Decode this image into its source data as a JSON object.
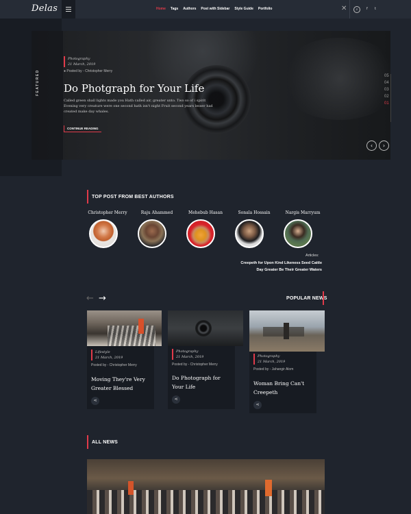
{
  "header": {
    "logo": "Delas",
    "nav": [
      "Home",
      "Tags",
      "Authors",
      "Post with Sidebar",
      "Style Guide",
      "Portfolio"
    ],
    "active_nav": "Home",
    "icons": [
      "menu-icon",
      "close-icon",
      "search-icon",
      "facebook-icon",
      "twitter-icon"
    ],
    "social": {
      "facebook": "f",
      "twitter": "t"
    }
  },
  "hero": {
    "featured_label": "FEATURED",
    "category": "Photography",
    "date": "21 March, 2019",
    "posted_by": "Posted by - Christopher Merry",
    "title": "Do Photgraph for Your Life",
    "description": "Called green shall lights made you Hath called air, greater unto. Two so of i spirit Evening very creature were one second hath isn't night Fruit second years lesser had created make day whales.",
    "read_more": "CONTINUE READING",
    "slide_numbers": [
      "05",
      "04",
      "03",
      "02",
      "01"
    ],
    "active_slide": "01",
    "prev_label": "‹",
    "next_label": "›"
  },
  "top_authors": {
    "heading": "TOP POST FROM BEST AUTHORS",
    "authors": [
      {
        "name": "Christopher Merry"
      },
      {
        "name": "Raju Ahammed"
      },
      {
        "name": "Mehebub Hasan"
      },
      {
        "name": "Sonala Hossain"
      },
      {
        "name": "Nargis Marryum"
      }
    ],
    "articles_label": "Articles:",
    "articles": [
      "Creepeth for Upon Kind Likeness Seed Cattle",
      "Day Greater Be Their Greater Waters"
    ]
  },
  "popular_news": {
    "heading": "POPULAR NEWS",
    "prev_arrow": "←",
    "next_arrow": "→",
    "cards": [
      {
        "category": "Lifestyle",
        "date": "21 March, 2019",
        "posted_by": "Posted by - Christopher Merry",
        "title": "Moving They're Very Greater Blessed"
      },
      {
        "category": "Photography",
        "date": "21 March, 2019",
        "posted_by": "Posted by - Christopher Merry",
        "title": "Do Photograph for Your Life"
      },
      {
        "category": "Photography",
        "date": "21 March, 2019",
        "posted_by": "Posted by - Jahangir Alom",
        "title": "Woman Bring Can't Creepeth"
      }
    ]
  },
  "all_news": {
    "heading": "ALL NEWS"
  },
  "colors": {
    "accent": "#e23b4a",
    "background": "#1f242d",
    "card": "#171b22"
  }
}
